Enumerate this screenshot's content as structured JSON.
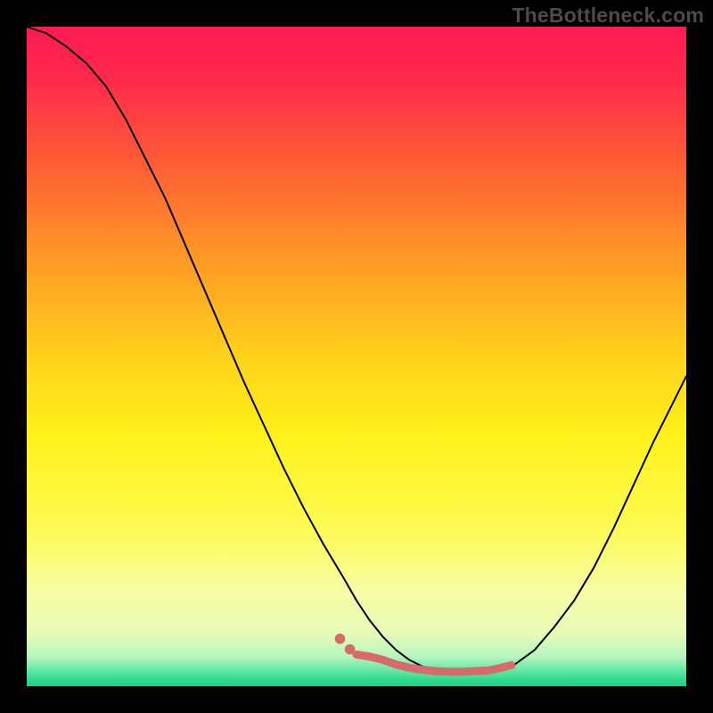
{
  "watermark": "TheBottleneck.com",
  "chart_data": {
    "type": "line",
    "title": "",
    "xlabel": "",
    "ylabel": "",
    "xlim": [
      0,
      100
    ],
    "ylim": [
      0,
      100
    ],
    "gradient_stops": [
      {
        "offset": 0.0,
        "color": "#ff1a53"
      },
      {
        "offset": 0.08,
        "color": "#ff2a4a"
      },
      {
        "offset": 0.2,
        "color": "#ff5a36"
      },
      {
        "offset": 0.35,
        "color": "#ff9826"
      },
      {
        "offset": 0.5,
        "color": "#ffd21a"
      },
      {
        "offset": 0.62,
        "color": "#fff11a"
      },
      {
        "offset": 0.76,
        "color": "#fdfb52"
      },
      {
        "offset": 0.85,
        "color": "#f8fca0"
      },
      {
        "offset": 0.92,
        "color": "#e6fbb8"
      },
      {
        "offset": 0.955,
        "color": "#b5f6bf"
      },
      {
        "offset": 0.975,
        "color": "#68e8a6"
      },
      {
        "offset": 0.99,
        "color": "#2fdc8c"
      },
      {
        "offset": 1.0,
        "color": "#1fd184"
      }
    ],
    "series": [
      {
        "name": "bottleneck-curve",
        "stroke": "#000000",
        "stroke_width": 2,
        "x": [
          0,
          3,
          6,
          9,
          12,
          15,
          18,
          21,
          24,
          27,
          30,
          33,
          36,
          39,
          42,
          45,
          48,
          50,
          52,
          54,
          56,
          58,
          60,
          62,
          64,
          66,
          68,
          70,
          72,
          74,
          77,
          80,
          83,
          86,
          89,
          92,
          95,
          98,
          100
        ],
        "y": [
          100,
          99,
          97,
          94.5,
          91,
          86,
          80,
          74,
          67,
          60,
          53,
          46,
          39.5,
          33,
          27,
          21.5,
          16.5,
          13,
          10,
          7.5,
          5.5,
          4.0,
          3.0,
          2.4,
          2.1,
          2.0,
          2.0,
          2.1,
          2.5,
          3.3,
          5.5,
          9.0,
          13,
          18,
          24,
          30.5,
          37,
          43,
          47
        ]
      },
      {
        "name": "highlight-band",
        "stroke": "#d86a6a",
        "stroke_width": 9,
        "x": [
          50,
          52,
          54,
          56,
          58,
          60,
          62,
          64,
          66,
          68,
          70,
          72,
          73.5
        ],
        "y": [
          4.8,
          4.5,
          4.0,
          3.3,
          2.8,
          2.5,
          2.3,
          2.2,
          2.2,
          2.3,
          2.4,
          2.8,
          3.2
        ]
      },
      {
        "name": "highlight-dot-1",
        "type": "dot",
        "stroke": "#d86a6a",
        "radius": 5.8,
        "x": [
          47.5
        ],
        "y": [
          7.2
        ]
      },
      {
        "name": "highlight-dot-2",
        "type": "dot",
        "stroke": "#d86a6a",
        "radius": 5.8,
        "x": [
          49.0
        ],
        "y": [
          5.6
        ]
      }
    ]
  }
}
